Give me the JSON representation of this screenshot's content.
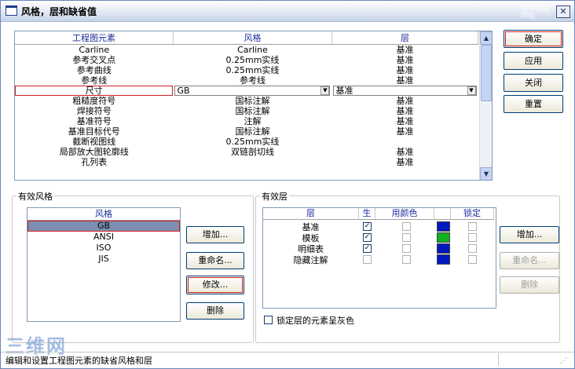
{
  "window": {
    "title": "风格，层和缺省值"
  },
  "grid": {
    "headers": [
      "工程图元素",
      "风格",
      "层"
    ],
    "rows": [
      [
        "Carline",
        "Carline",
        "基准"
      ],
      [
        "参考交叉点",
        "0.25mm实线",
        "基准"
      ],
      [
        "参考曲线",
        "0.25mm实线",
        "基准"
      ],
      [
        "参考线",
        "参考线",
        "基准"
      ],
      [
        "尺寸",
        "GB",
        "基准"
      ],
      [
        "粗糙度符号",
        "国标注解",
        "基准"
      ],
      [
        "焊接符号",
        "国标注解",
        "基准"
      ],
      [
        "基准符号",
        "注解",
        "基准"
      ],
      [
        "基准目标代号",
        "国标注解",
        "基准"
      ],
      [
        "截断视图线",
        "0.25mm实线",
        ""
      ],
      [
        "局部放大图轮廓线",
        "双链剖切线",
        "基准"
      ],
      [
        "孔列表",
        "",
        "基准"
      ]
    ]
  },
  "buttons": {
    "ok": "确定",
    "apply": "应用",
    "close": "关闭",
    "reset": "重置"
  },
  "styles_group": {
    "label": "有效风格",
    "header": "风格",
    "items": [
      "GB",
      "ANSI",
      "ISO",
      "JIS"
    ],
    "add": "增加...",
    "rename": "重命名...",
    "modify": "修改...",
    "delete": "删除"
  },
  "layers_group": {
    "label": "有效层",
    "headers": [
      "层",
      "生",
      "用颜色",
      "",
      "锁定"
    ],
    "layers": [
      {
        "name": "基准",
        "visible": true,
        "use_color": false,
        "color": "#0018c0",
        "locked": false
      },
      {
        "name": "模板",
        "visible": true,
        "use_color": false,
        "color": "#10b020",
        "locked": false
      },
      {
        "name": "明细表",
        "visible": true,
        "use_color": false,
        "color": "#0018c0",
        "locked": false
      },
      {
        "name": "隐藏注解",
        "visible": false,
        "use_color": false,
        "color": "#0018c0",
        "locked": false
      }
    ],
    "add": "增加...",
    "rename": "重命名...",
    "delete": "删除",
    "gray_locked_label": "锁定层的元素呈灰色"
  },
  "status": {
    "text": "编辑和设置工程图元素的缺省风格和层"
  },
  "watermark": "三维网"
}
